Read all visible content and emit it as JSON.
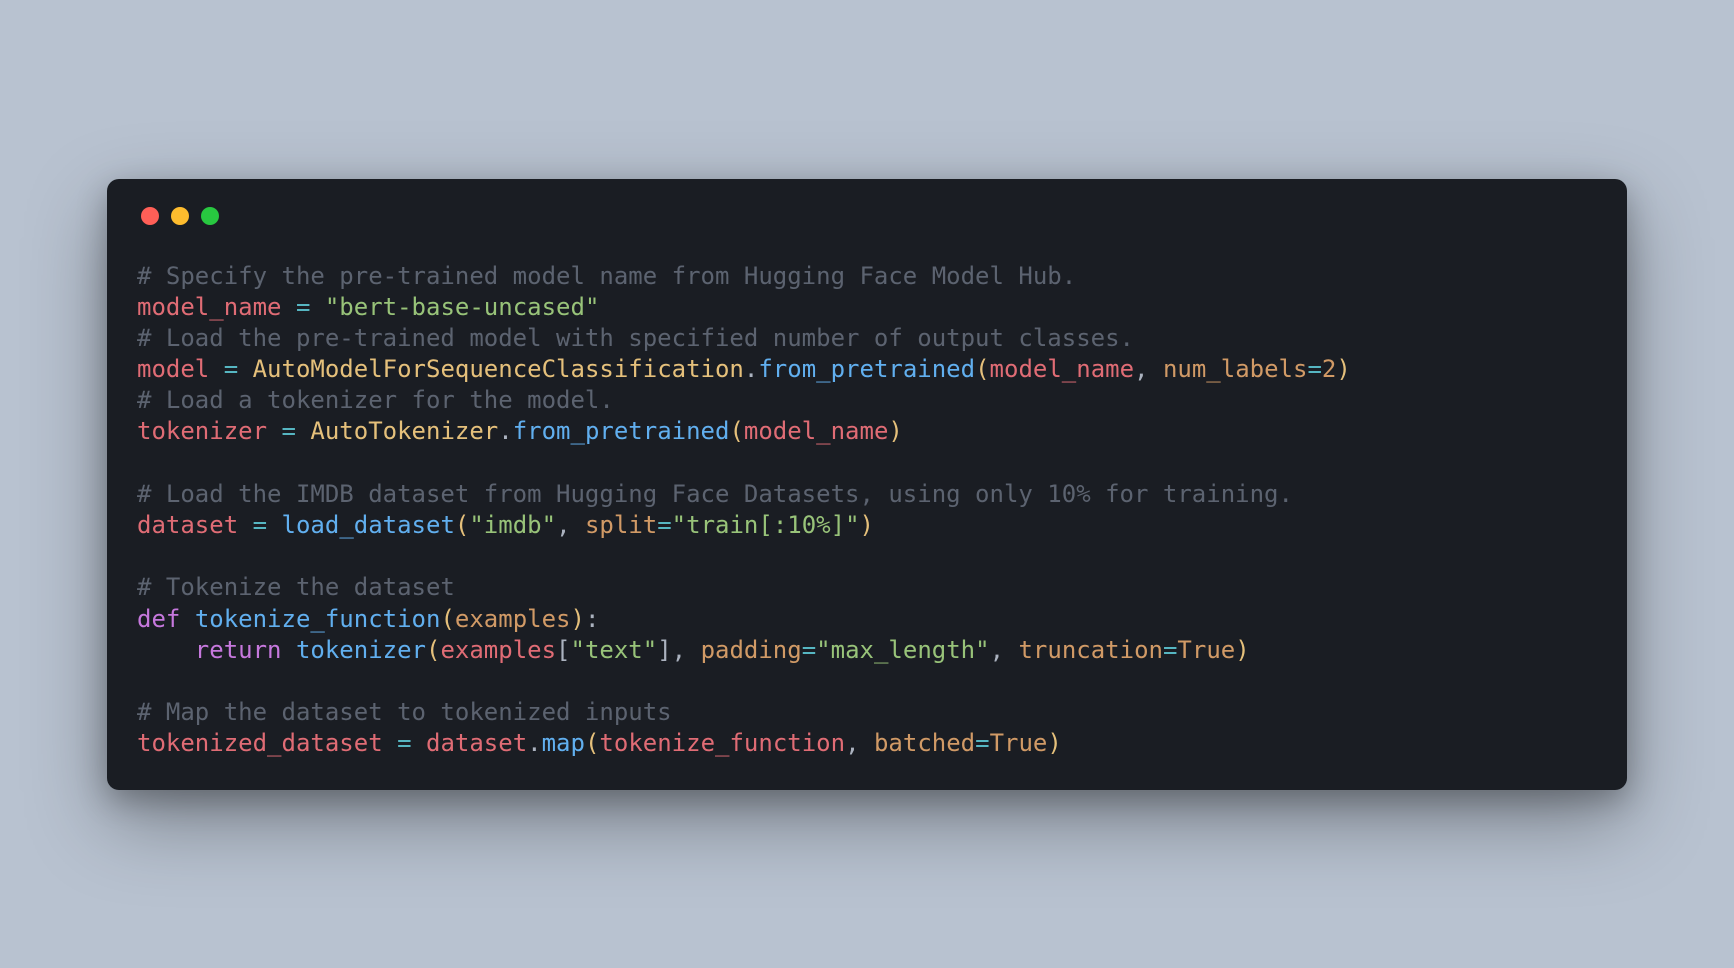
{
  "lines": {
    "c1": "# Specify the pre-trained model name from Hugging Face Model Hub.",
    "l2_ident": "model_name",
    "l2_str": "\"bert-base-uncased\"",
    "c3": "# Load the pre-trained model with specified number of output classes.",
    "l4_ident": "model",
    "l4_class": "AutoModelForSequenceClassification",
    "l4_method": "from_pretrained",
    "l4_arg1": "model_name",
    "l4_kw": "num_labels",
    "l4_num": "2",
    "c5": "# Load a tokenizer for the model.",
    "l6_ident": "tokenizer",
    "l6_class": "AutoTokenizer",
    "l6_method": "from_pretrained",
    "l6_arg": "model_name",
    "c7": "# Load the IMDB dataset from Hugging Face Datasets, using only 10% for training.",
    "l8_ident": "dataset",
    "l8_call": "load_dataset",
    "l8_str1": "\"imdb\"",
    "l8_kw": "split",
    "l8_str2": "\"train[:10%]\"",
    "c9": "# Tokenize the dataset",
    "l10_def": "def",
    "l10_fn": "tokenize_function",
    "l10_param": "examples",
    "l11_ret": "return",
    "l11_call": "tokenizer",
    "l11_arg": "examples",
    "l11_key": "\"text\"",
    "l11_kw1": "padding",
    "l11_str": "\"max_length\"",
    "l11_kw2": "truncation",
    "l11_true": "True",
    "c12": "# Map the dataset to tokenized inputs",
    "l13_ident": "tokenized_dataset",
    "l13_obj": "dataset",
    "l13_method": "map",
    "l13_arg": "tokenize_function",
    "l13_kw": "batched",
    "l13_true": "True"
  }
}
